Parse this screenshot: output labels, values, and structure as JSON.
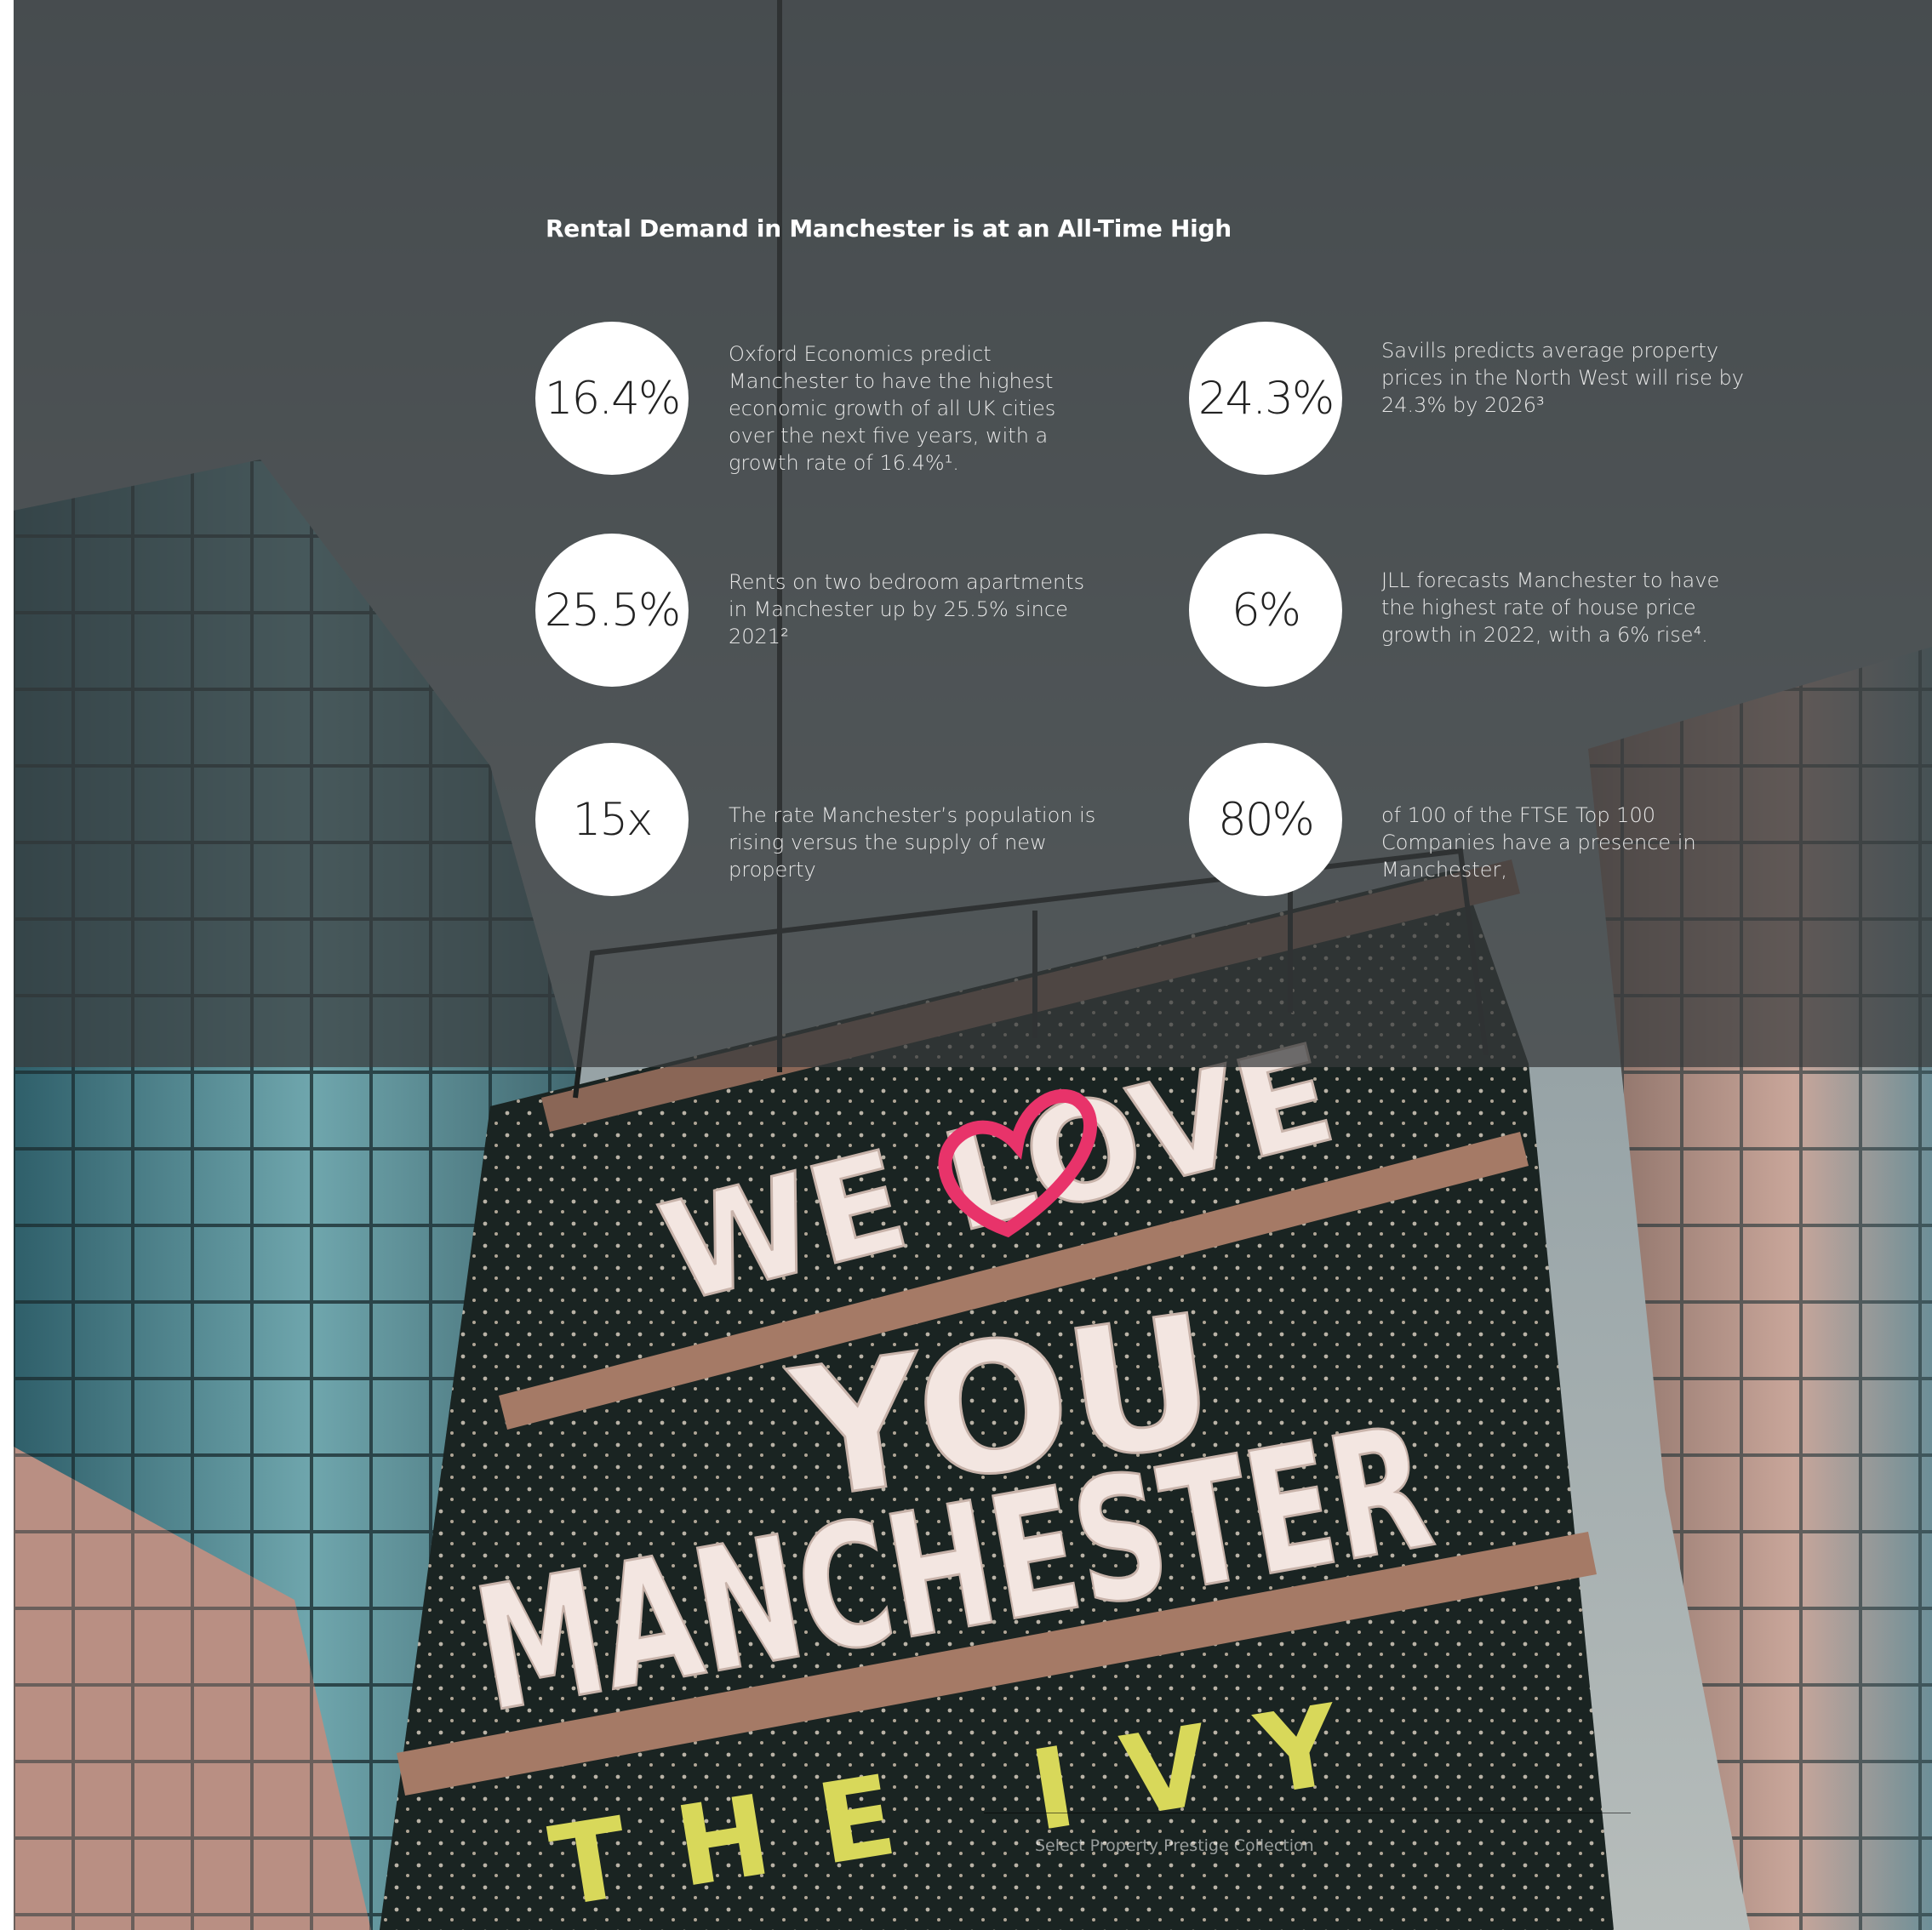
{
  "headline": "Rental Demand in Manchester is at an All-Time High",
  "stats": [
    {
      "value": "16.4%",
      "text": "Oxford Economics predict Manchester to have the highest economic growth of all UK cities over the next five years, with a growth rate of 16.4%¹."
    },
    {
      "value": "24.3%",
      "text": "Savills predicts average property prices in the North West will rise by 24.3% by 2026³"
    },
    {
      "value": "25.5%",
      "text": "Rents on two bedroom apartments in Manchester up by 25.5% since 2021²"
    },
    {
      "value": "6%",
      "text": "JLL forecasts Manchester to have the highest rate of house price growth in 2022, with a 6% rise⁴."
    },
    {
      "value": "15x",
      "text": "The rate Manchester’s population is rising versus the supply of new property"
    },
    {
      "value": "80%",
      "text": "of 100 of the FTSE Top 100 Companies have a presence in Manchester,"
    }
  ],
  "sign": {
    "line1": "WE LOVE",
    "line2": "YOU",
    "line3": "MANCHESTER",
    "line4": "THE IVY"
  },
  "footer": "Select Property Prestige Collection",
  "colors": {
    "overlay": "#373a3c",
    "circle": "#ffffff",
    "heart": "#e8336a",
    "ivy_letters": "#d8d85a",
    "sign_letters": "#f3e6e1"
  }
}
